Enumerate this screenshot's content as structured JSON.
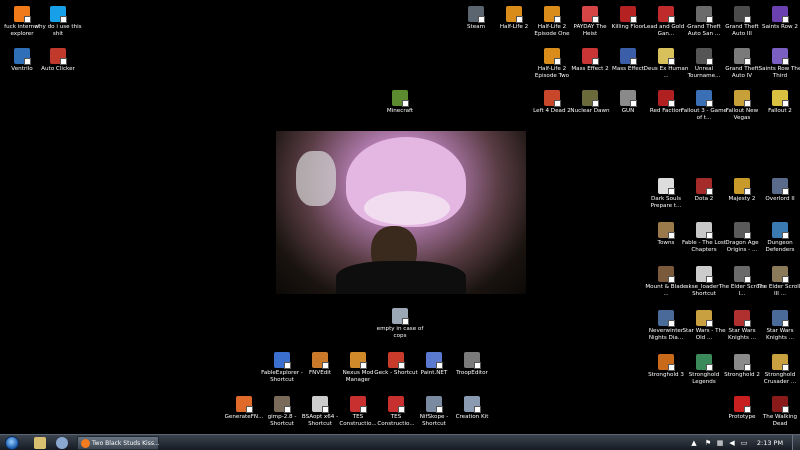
{
  "desktop": {
    "icons": [
      {
        "label": "fuck internet explorer",
        "icon": "firefox-icon",
        "color": "#f07a1a"
      },
      {
        "label": "why do i use this shit",
        "icon": "skype-icon",
        "color": "#17a0e8"
      },
      {
        "label": "Ventrilo",
        "icon": "ventrilo-icon",
        "color": "#2f6fb8"
      },
      {
        "label": "Auto Clicker",
        "icon": "cursor-icon",
        "color": "#c0392b"
      },
      {
        "label": "Steam",
        "icon": "steam-icon",
        "color": "#5a6570"
      },
      {
        "label": "Half-Life 2",
        "icon": "half-life-icon",
        "color": "#d98c1a"
      },
      {
        "label": "Half-Life 2 Episode One",
        "icon": "half-life-icon",
        "color": "#d98c1a"
      },
      {
        "label": "PAYDAY The Heist",
        "icon": "payday-icon",
        "color": "#d64545"
      },
      {
        "label": "Killing Floor",
        "icon": "killing-floor-icon",
        "color": "#b52020"
      },
      {
        "label": "Lead and Gold - Gan...",
        "icon": "lead-and-gold-icon",
        "color": "#c02a2a"
      },
      {
        "label": "Grand Theft Auto San ...",
        "icon": "gta-icon",
        "color": "#6b6b6b"
      },
      {
        "label": "Grand Theft Auto III",
        "icon": "gta-icon",
        "color": "#4b4b4b"
      },
      {
        "label": "Saints Row 2",
        "icon": "saints-row-icon",
        "color": "#6a3fb0"
      },
      {
        "label": "Half-Life 2 Episode Two",
        "icon": "half-life-icon",
        "color": "#d98c1a"
      },
      {
        "label": "Mass Effect 2",
        "icon": "mass-effect-icon",
        "color": "#c93434"
      },
      {
        "label": "Mass Effect",
        "icon": "mass-effect-icon",
        "color": "#3a5ea8"
      },
      {
        "label": "Deus Ex Human ...",
        "icon": "deus-ex-icon",
        "color": "#d8c05a"
      },
      {
        "label": "Unreal Tourname...",
        "icon": "unreal-icon",
        "color": "#555555"
      },
      {
        "label": "Grand Theft Auto IV",
        "icon": "gta-icon",
        "color": "#7a7a7a"
      },
      {
        "label": "Saints Row The Third",
        "icon": "saints-row-icon",
        "color": "#7a5fc0"
      },
      {
        "label": "Minecraft",
        "icon": "minecraft-icon",
        "color": "#5b8a2f"
      },
      {
        "label": "Left 4 Dead 2",
        "icon": "left4dead-icon",
        "color": "#c8472a"
      },
      {
        "label": "Nuclear Dawn",
        "icon": "nuclear-dawn-icon",
        "color": "#6a6a3a"
      },
      {
        "label": "GUN",
        "icon": "gun-icon",
        "color": "#8a8a8a"
      },
      {
        "label": "Red Faction",
        "icon": "red-faction-icon",
        "color": "#b02020"
      },
      {
        "label": "Fallout 3 - Game of t...",
        "icon": "fallout-icon",
        "color": "#3a6fb5"
      },
      {
        "label": "Fallout New Vegas",
        "icon": "fallout-icon",
        "color": "#c8a03a"
      },
      {
        "label": "Fallout 2",
        "icon": "fallout-icon",
        "color": "#d9c040"
      },
      {
        "label": "Dark Souls Prepare t...",
        "icon": "shortcut-icon",
        "color": "#dddddd"
      },
      {
        "label": "Dota 2",
        "icon": "dota-icon",
        "color": "#a52a2a"
      },
      {
        "label": "Majesty 2",
        "icon": "majesty-icon",
        "color": "#c89a2a"
      },
      {
        "label": "Overlord II",
        "icon": "overlord-icon",
        "color": "#5a6a8a"
      },
      {
        "label": "Towns",
        "icon": "towns-icon",
        "color": "#9a7a4a"
      },
      {
        "label": "Fable - The Lost Chapters",
        "icon": "fable-icon",
        "color": "#c8c8c8"
      },
      {
        "label": "Dragon Age Origins - ...",
        "icon": "dragon-age-icon",
        "color": "#5a5a5a"
      },
      {
        "label": "Dungeon Defenders",
        "icon": "dungeon-defenders-icon",
        "color": "#3a7ab0"
      },
      {
        "label": "Mount & Blade ...",
        "icon": "mount-blade-icon",
        "color": "#7a5a3a"
      },
      {
        "label": "skse_loader - Shortcut",
        "icon": "shortcut-icon",
        "color": "#cccccc"
      },
      {
        "label": "The Elder Scrolls I...",
        "icon": "elder-scrolls-icon",
        "color": "#6a6a6a"
      },
      {
        "label": "The Elder Scrolls III ...",
        "icon": "elder-scrolls-icon",
        "color": "#8a7a5a"
      },
      {
        "label": "Neverwinter Nights Dia...",
        "icon": "neverwinter-icon",
        "color": "#4a6a9a"
      },
      {
        "label": "Star Wars - The Old ...",
        "icon": "star-wars-icon",
        "color": "#c8a040"
      },
      {
        "label": "Star Wars Knights ...",
        "icon": "star-wars-icon",
        "color": "#b03030"
      },
      {
        "label": "Star Wars Knights ...",
        "icon": "star-wars-icon",
        "color": "#4a6a9a"
      },
      {
        "label": "Stronghold 3",
        "icon": "stronghold-icon",
        "color": "#c86a1a"
      },
      {
        "label": "Stronghold Legends",
        "icon": "stronghold-icon",
        "color": "#3a8a5a"
      },
      {
        "label": "Stronghold 2",
        "icon": "stronghold-icon",
        "color": "#8a8a8a"
      },
      {
        "label": "Stronghold Crusader ...",
        "icon": "stronghold-icon",
        "color": "#c8a040"
      },
      {
        "label": "empty in case of cops",
        "icon": "recycle-bin-icon",
        "color": "#9aa7b5"
      },
      {
        "label": "FableExplorer - Shortcut",
        "icon": "shortcut-icon",
        "color": "#3a6fd0"
      },
      {
        "label": "FNVEdit",
        "icon": "fnvedit-icon",
        "color": "#c87a2a"
      },
      {
        "label": "Nexus Mod Manager",
        "icon": "nexus-icon",
        "color": "#d08a2a"
      },
      {
        "label": "Geck - Shortcut",
        "icon": "geck-icon",
        "color": "#c83a2a"
      },
      {
        "label": "Paint.NET",
        "icon": "paint-net-icon",
        "color": "#5a7ad0"
      },
      {
        "label": "TroopEditor",
        "icon": "editor-icon",
        "color": "#7a7a7a"
      },
      {
        "label": "GenerateFN...",
        "icon": "generate-icon",
        "color": "#e06a2a"
      },
      {
        "label": "gimp-2.8 - Shortcut",
        "icon": "gimp-icon",
        "color": "#7a6a5a"
      },
      {
        "label": "BSAopt x64 - Shortcut",
        "icon": "shortcut-icon",
        "color": "#cccccc"
      },
      {
        "label": "TES Constructio...",
        "icon": "tes-construction-icon",
        "color": "#c83030"
      },
      {
        "label": "TES Constructio...",
        "icon": "tes-construction-icon",
        "color": "#c83030"
      },
      {
        "label": "NifSkope - Shortcut",
        "icon": "nifskope-icon",
        "color": "#7a8aa0"
      },
      {
        "label": "Creation Kit",
        "icon": "creation-kit-icon",
        "color": "#8a9ab0"
      },
      {
        "label": "Prototype",
        "icon": "prototype-icon",
        "color": "#c82020"
      },
      {
        "label": "The Walking Dead",
        "icon": "walking-dead-icon",
        "color": "#8a1a1a"
      }
    ]
  },
  "taskbar": {
    "task_label": "Two Black Studs Kiss...",
    "task_icon_color": "#f37b20",
    "clock": "2:13 PM"
  }
}
